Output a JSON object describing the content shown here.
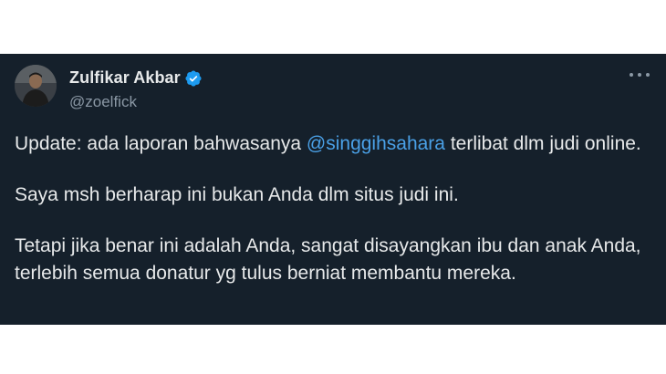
{
  "author": {
    "display_name": "Zulfikar Akbar",
    "handle": "@zoelfick",
    "verified": true
  },
  "tweet": {
    "p1_before": "Update: ada laporan bahwasanya ",
    "p1_mention": "@singgihsahara",
    "p1_after": " terlibat dlm judi online.",
    "p2": "Saya msh berharap ini bukan Anda dlm situs judi ini.",
    "p3": "Tetapi jika benar ini adalah Anda, sangat disayangkan ibu dan anak Anda, terlebih semua donatur yg tulus berniat membantu mereka."
  },
  "colors": {
    "background": "#15202b",
    "text": "#e7e9ea",
    "secondary": "#8b98a5",
    "mention": "#4aa0e6",
    "verified_badge": "#1d9bf0"
  },
  "icons": {
    "verified": "verified-badge-icon",
    "more": "more-options-icon"
  }
}
